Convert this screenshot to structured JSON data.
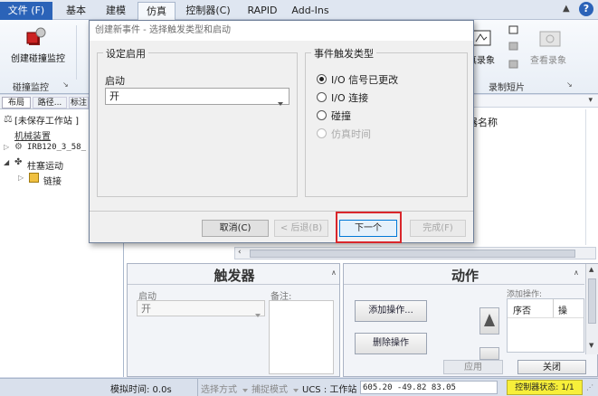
{
  "menu": {
    "tabs": [
      "文件 (F)",
      "基本",
      "建模",
      "仿真",
      "控制器(C)",
      "RAPID",
      "Add-Ins"
    ]
  },
  "ribbon": {
    "create_collision_label": "创建碰撞监控",
    "collision_group_label": "碰撞监控",
    "record_label": "真录象",
    "view_record_label": "查看录象",
    "record_group_label": "录制短片"
  },
  "left_pane": {
    "tabs": [
      "布局",
      "路径...",
      "标注"
    ],
    "tree": [
      "[未保存工作站 ]",
      "机械装置",
      "IRB120_3_58_",
      "柱塞运动",
      "链接"
    ]
  },
  "right_area": {
    "col_header": "器名称"
  },
  "trigger_panel": {
    "title": "触发器",
    "start_label": "启动",
    "start_value": "开",
    "note_label": "备注:"
  },
  "action_panel": {
    "title": "动作",
    "add_action_button": "添加操作...",
    "delete_action_button": "删除操作",
    "added_label": "添加操作:",
    "col_order": "序否",
    "col_op": "操",
    "apply_button": "应用",
    "close_button": "关闭"
  },
  "statusbar": {
    "sim_time": "模拟时间: 0.0s",
    "select_mode": "选择方式",
    "snap_mode": "捕捉模式",
    "ucs": "UCS : 工作站",
    "coords": "605.20  -49.82  83.05",
    "controller_status": "控制器状态: 1/1"
  },
  "dialog": {
    "title": "创建新事件 - 选择触发类型和启动",
    "setup_group": "设定启用",
    "start_label": "启动",
    "start_value": "开",
    "trigger_group": "事件触发类型",
    "options": [
      "I/O 信号已更改",
      "I/O 连接",
      "碰撞",
      "仿真时间"
    ],
    "selected_option": "I/O 信号已更改",
    "cancel_button": "取消(C)",
    "back_button": "< 后退(B)",
    "next_button": "下一个",
    "finish_button": "完成(F)"
  },
  "colors": {
    "file_tab": "#2b63b8",
    "highlight_red": "#d9262b",
    "controller_badge": "#f7ef3a"
  }
}
